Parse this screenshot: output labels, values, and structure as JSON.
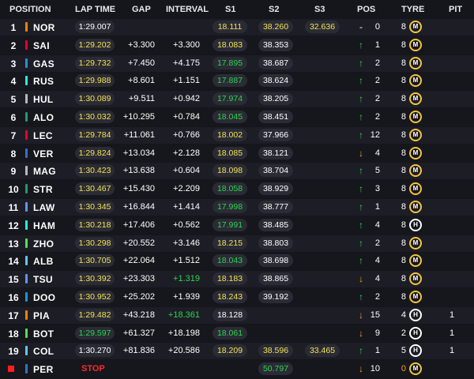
{
  "headers": {
    "position": "POSITION",
    "lap_time": "LAP TIME",
    "gap": "GAP",
    "interval": "INTERVAL",
    "s1": "S1",
    "s2": "S2",
    "s3": "S3",
    "pos": "POS",
    "tyre": "TYRE",
    "pit": "PIT"
  },
  "rows": [
    {
      "pos": "1",
      "driver": "NOR",
      "team_color": "#ff8000",
      "lap": "1:29.007",
      "lap_color": "white",
      "gap": "",
      "int": "",
      "s1": "18.111",
      "s1c": "yellow",
      "s2": "38.260",
      "s2c": "yellow",
      "s3": "32.636",
      "s3c": "yellow",
      "arrow": "-",
      "arrow_color": "white",
      "posn": "0",
      "laps": "8",
      "tyre": "M",
      "pit": ""
    },
    {
      "pos": "2",
      "driver": "SAI",
      "team_color": "#e8002d",
      "lap": "1:29.202",
      "lap_color": "yellow",
      "gap": "+3.300",
      "int": "+3.300",
      "s1": "18.083",
      "s1c": "yellow",
      "s2": "38.353",
      "s2c": "white",
      "s3": "",
      "s3c": "white",
      "arrow": "↑",
      "arrow_color": "green",
      "posn": "1",
      "laps": "8",
      "tyre": "M",
      "pit": ""
    },
    {
      "pos": "3",
      "driver": "GAS",
      "team_color": "#2293d1",
      "lap": "1:29.732",
      "lap_color": "yellow",
      "gap": "+7.450",
      "int": "+4.175",
      "s1": "17.895",
      "s1c": "green",
      "s2": "38.687",
      "s2c": "white",
      "s3": "",
      "s3c": "white",
      "arrow": "↑",
      "arrow_color": "green",
      "posn": "2",
      "laps": "8",
      "tyre": "M",
      "pit": ""
    },
    {
      "pos": "4",
      "driver": "RUS",
      "team_color": "#27f4d2",
      "lap": "1:29.988",
      "lap_color": "yellow",
      "gap": "+8.601",
      "int": "+1.151",
      "s1": "17.887",
      "s1c": "green",
      "s2": "38.624",
      "s2c": "white",
      "s3": "",
      "s3c": "white",
      "arrow": "↑",
      "arrow_color": "green",
      "posn": "2",
      "laps": "8",
      "tyre": "M",
      "pit": ""
    },
    {
      "pos": "5",
      "driver": "HUL",
      "team_color": "#b6babd",
      "lap": "1:30.089",
      "lap_color": "yellow",
      "gap": "+9.511",
      "int": "+0.942",
      "s1": "17.974",
      "s1c": "green",
      "s2": "38.205",
      "s2c": "white",
      "s3": "",
      "s3c": "white",
      "arrow": "↑",
      "arrow_color": "green",
      "posn": "2",
      "laps": "8",
      "tyre": "M",
      "pit": ""
    },
    {
      "pos": "6",
      "driver": "ALO",
      "team_color": "#229971",
      "lap": "1:30.032",
      "lap_color": "yellow",
      "gap": "+10.295",
      "int": "+0.784",
      "s1": "18.045",
      "s1c": "green",
      "s2": "38.451",
      "s2c": "white",
      "s3": "",
      "s3c": "white",
      "arrow": "↑",
      "arrow_color": "green",
      "posn": "2",
      "laps": "8",
      "tyre": "M",
      "pit": ""
    },
    {
      "pos": "7",
      "driver": "LEC",
      "team_color": "#e8002d",
      "lap": "1:29.784",
      "lap_color": "yellow",
      "gap": "+11.061",
      "int": "+0.766",
      "s1": "18.002",
      "s1c": "yellow",
      "s2": "37.966",
      "s2c": "white",
      "s3": "",
      "s3c": "white",
      "arrow": "↑",
      "arrow_color": "green",
      "posn": "12",
      "laps": "8",
      "tyre": "M",
      "pit": ""
    },
    {
      "pos": "8",
      "driver": "VER",
      "team_color": "#3671c6",
      "lap": "1:29.824",
      "lap_color": "yellow",
      "gap": "+13.034",
      "int": "+2.128",
      "s1": "18.085",
      "s1c": "yellow",
      "s2": "38.121",
      "s2c": "white",
      "s3": "",
      "s3c": "white",
      "arrow": "↓",
      "arrow_color": "orange",
      "posn": "4",
      "laps": "8",
      "tyre": "M",
      "pit": ""
    },
    {
      "pos": "9",
      "driver": "MAG",
      "team_color": "#b6babd",
      "lap": "1:30.423",
      "lap_color": "yellow",
      "gap": "+13.638",
      "int": "+0.604",
      "s1": "18.098",
      "s1c": "yellow",
      "s2": "38.704",
      "s2c": "white",
      "s3": "",
      "s3c": "white",
      "arrow": "↑",
      "arrow_color": "green",
      "posn": "5",
      "laps": "8",
      "tyre": "M",
      "pit": ""
    },
    {
      "pos": "10",
      "driver": "STR",
      "team_color": "#229971",
      "lap": "1:30.467",
      "lap_color": "yellow",
      "gap": "+15.430",
      "int": "+2.209",
      "s1": "18.058",
      "s1c": "green",
      "s2": "38.929",
      "s2c": "white",
      "s3": "",
      "s3c": "white",
      "arrow": "↑",
      "arrow_color": "green",
      "posn": "3",
      "laps": "8",
      "tyre": "M",
      "pit": ""
    },
    {
      "pos": "11",
      "driver": "LAW",
      "team_color": "#6692ff",
      "lap": "1:30.345",
      "lap_color": "yellow",
      "gap": "+16.844",
      "int": "+1.414",
      "s1": "17.998",
      "s1c": "green",
      "s2": "38.777",
      "s2c": "white",
      "s3": "",
      "s3c": "white",
      "arrow": "↑",
      "arrow_color": "green",
      "posn": "1",
      "laps": "8",
      "tyre": "M",
      "pit": ""
    },
    {
      "pos": "12",
      "driver": "HAM",
      "team_color": "#27f4d2",
      "lap": "1:30.218",
      "lap_color": "yellow",
      "gap": "+17.406",
      "int": "+0.562",
      "s1": "17.991",
      "s1c": "green",
      "s2": "38.485",
      "s2c": "white",
      "s3": "",
      "s3c": "white",
      "arrow": "↑",
      "arrow_color": "green",
      "posn": "4",
      "laps": "8",
      "tyre": "H",
      "pit": ""
    },
    {
      "pos": "13",
      "driver": "ZHO",
      "team_color": "#52e252",
      "lap": "1:30.298",
      "lap_color": "yellow",
      "gap": "+20.552",
      "int": "+3.146",
      "s1": "18.215",
      "s1c": "yellow",
      "s2": "38.803",
      "s2c": "white",
      "s3": "",
      "s3c": "white",
      "arrow": "↑",
      "arrow_color": "green",
      "posn": "2",
      "laps": "8",
      "tyre": "M",
      "pit": ""
    },
    {
      "pos": "14",
      "driver": "ALB",
      "team_color": "#64c4ff",
      "lap": "1:30.705",
      "lap_color": "yellow",
      "gap": "+22.064",
      "int": "+1.512",
      "s1": "18.043",
      "s1c": "green",
      "s2": "38.698",
      "s2c": "white",
      "s3": "",
      "s3c": "white",
      "arrow": "↑",
      "arrow_color": "green",
      "posn": "4",
      "laps": "8",
      "tyre": "M",
      "pit": ""
    },
    {
      "pos": "15",
      "driver": "TSU",
      "team_color": "#6692ff",
      "lap": "1:30.392",
      "lap_color": "yellow",
      "gap": "+23.303",
      "int": "+1.319",
      "int_color": "green",
      "s1": "18.183",
      "s1c": "yellow",
      "s2": "38.865",
      "s2c": "white",
      "s3": "",
      "s3c": "white",
      "arrow": "↓",
      "arrow_color": "orange",
      "posn": "4",
      "laps": "8",
      "tyre": "M",
      "pit": ""
    },
    {
      "pos": "16",
      "driver": "DOO",
      "team_color": "#2293d1",
      "lap": "1:30.952",
      "lap_color": "yellow",
      "gap": "+25.202",
      "int": "+1.939",
      "s1": "18.243",
      "s1c": "yellow",
      "s2": "39.192",
      "s2c": "white",
      "s3": "",
      "s3c": "white",
      "arrow": "↑",
      "arrow_color": "green",
      "posn": "2",
      "laps": "8",
      "tyre": "M",
      "pit": ""
    },
    {
      "pos": "17",
      "driver": "PIA",
      "team_color": "#ff8000",
      "lap": "1:29.482",
      "lap_color": "yellow",
      "gap": "+43.218",
      "int": "+18.361",
      "int_color": "green",
      "s1": "18.128",
      "s1c": "white",
      "s2": "",
      "s2c": "white",
      "s3": "",
      "s3c": "white",
      "arrow": "↓",
      "arrow_color": "orange",
      "posn": "15",
      "laps": "4",
      "tyre": "H",
      "pit": "1"
    },
    {
      "pos": "18",
      "driver": "BOT",
      "team_color": "#52e252",
      "lap": "1:29.597",
      "lap_color": "green",
      "gap": "+61.327",
      "int": "+18.198",
      "s1": "18.061",
      "s1c": "green",
      "s2": "",
      "s2c": "white",
      "s3": "",
      "s3c": "white",
      "arrow": "↓",
      "arrow_color": "orange",
      "posn": "9",
      "laps": "2",
      "tyre": "H",
      "pit": "1"
    },
    {
      "pos": "19",
      "driver": "COL",
      "team_color": "#64c4ff",
      "lap": "1:30.270",
      "lap_color": "white",
      "gap": "+81.836",
      "int": "+20.586",
      "s1": "18.209",
      "s1c": "yellow",
      "s2": "38.596",
      "s2c": "yellow",
      "s3": "33.465",
      "s3c": "yellow",
      "arrow": "↑",
      "arrow_color": "green",
      "posn": "1",
      "laps": "5",
      "tyre": "H",
      "pit": "1"
    },
    {
      "pos": "",
      "driver": "PER",
      "team_color": "#3671c6",
      "stop": "STOP",
      "lap": "",
      "lap_color": "white",
      "gap": "",
      "int": "",
      "s1": "",
      "s1c": "white",
      "s2": "50.797",
      "s2c": "green",
      "s3": "",
      "s3c": "white",
      "arrow": "↓",
      "arrow_color": "orange",
      "posn": "10",
      "laps": "0",
      "tyre": "M",
      "pit": ""
    }
  ]
}
